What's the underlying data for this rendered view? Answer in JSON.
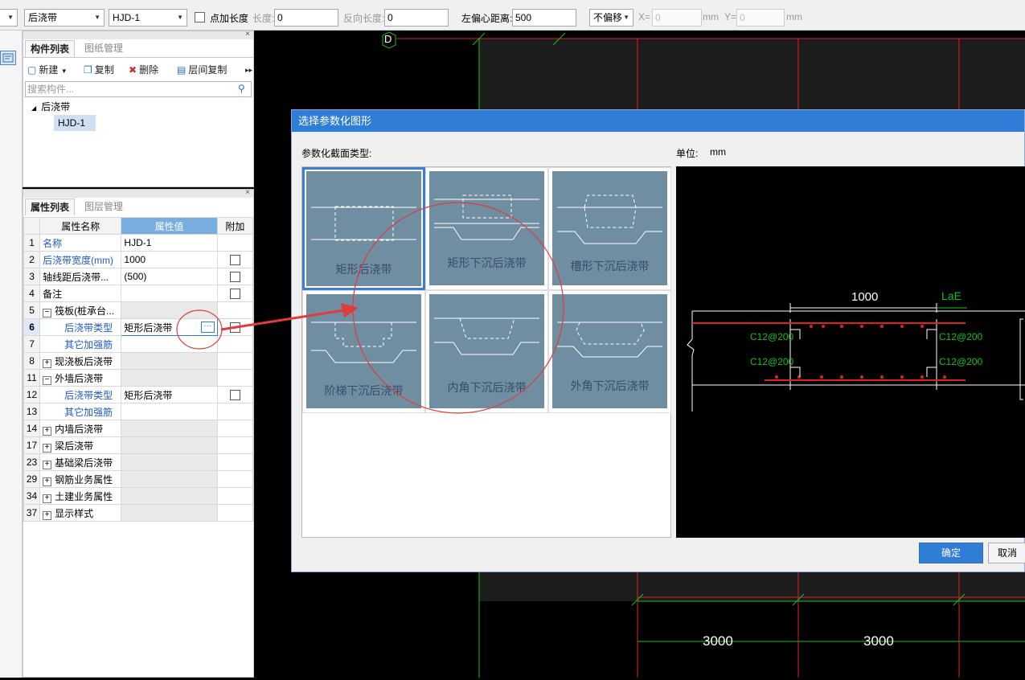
{
  "toolbar": {
    "category_combo": "后浇带",
    "component_combo": "HJD-1",
    "point_length_label": "点加长度",
    "length_label": "长度:",
    "length_value": "0",
    "reverse_length_label": "反向长度:",
    "reverse_length_value": "0",
    "left_offset_label": "左偏心距离:",
    "left_offset_value": "500",
    "offset_combo": "不偏移",
    "x_label": "X=",
    "x_value": "0",
    "x_unit": "mm",
    "y_label": "Y=",
    "y_value": "0",
    "y_unit": "mm"
  },
  "component_panel": {
    "tabs": [
      "构件列表",
      "图纸管理"
    ],
    "buttons": {
      "new": "新建",
      "copy": "复制",
      "delete": "删除",
      "floor_copy": "层间复制"
    },
    "search_placeholder": "搜索构件...",
    "tree_root": "后浇带",
    "tree_child": "HJD-1"
  },
  "property_panel": {
    "tabs": [
      "属性列表",
      "图层管理"
    ],
    "headers": {
      "name": "属性名称",
      "value": "属性值",
      "extra": "附加"
    },
    "rows": [
      {
        "num": "1",
        "name": "名称",
        "value": "HJD-1"
      },
      {
        "num": "2",
        "name": "后浇带宽度(mm)",
        "value": "1000"
      },
      {
        "num": "3",
        "name": "轴线距后浇带...",
        "value": "(500)"
      },
      {
        "num": "4",
        "name": "备注",
        "value": ""
      },
      {
        "num": "5",
        "name": "筏板(桩承台...",
        "value": ""
      },
      {
        "num": "6",
        "name": "后浇带类型",
        "value": "矩形后浇带"
      },
      {
        "num": "7",
        "name": "其它加强筋",
        "value": ""
      },
      {
        "num": "8",
        "name": "现浇板后浇带",
        "value": ""
      },
      {
        "num": "11",
        "name": "外墙后浇带",
        "value": ""
      },
      {
        "num": "12",
        "name": "后浇带类型",
        "value": "矩形后浇带"
      },
      {
        "num": "13",
        "name": "其它加强筋",
        "value": ""
      },
      {
        "num": "14",
        "name": "内墙后浇带",
        "value": ""
      },
      {
        "num": "17",
        "name": "梁后浇带",
        "value": ""
      },
      {
        "num": "23",
        "name": "基础梁后浇带",
        "value": ""
      },
      {
        "num": "29",
        "name": "钢筋业务属性",
        "value": ""
      },
      {
        "num": "34",
        "name": "土建业务属性",
        "value": ""
      },
      {
        "num": "37",
        "name": "显示样式",
        "value": ""
      }
    ],
    "ellipsis": "···"
  },
  "canvas": {
    "axis_label": "D",
    "dim_1": "3000",
    "dim_2": "3000"
  },
  "dialog": {
    "title": "选择参数化图形",
    "section_label": "参数化截面类型:",
    "unit_label": "单位:",
    "unit_value": "mm",
    "shapes": [
      "矩形后浇带",
      "矩形下沉后浇带",
      "槽形下沉后浇带",
      "阶梯下沉后浇带",
      "内角下沉后浇带",
      "外角下沉后浇带"
    ],
    "preview": {
      "width_dim": "1000",
      "lae_label": "LaE",
      "rebar_tl": "C12@200",
      "rebar_bl": "C12@200",
      "rebar_tr": "C12@200",
      "rebar_br": "C12@200"
    },
    "ok_button": "确定",
    "cancel_button": "取消"
  },
  "colors": {
    "accent": "#2f7dd7",
    "thumb_bg": "#6f8ea2",
    "annotation_red": "#e23b3b",
    "cad_green": "#16c116"
  }
}
